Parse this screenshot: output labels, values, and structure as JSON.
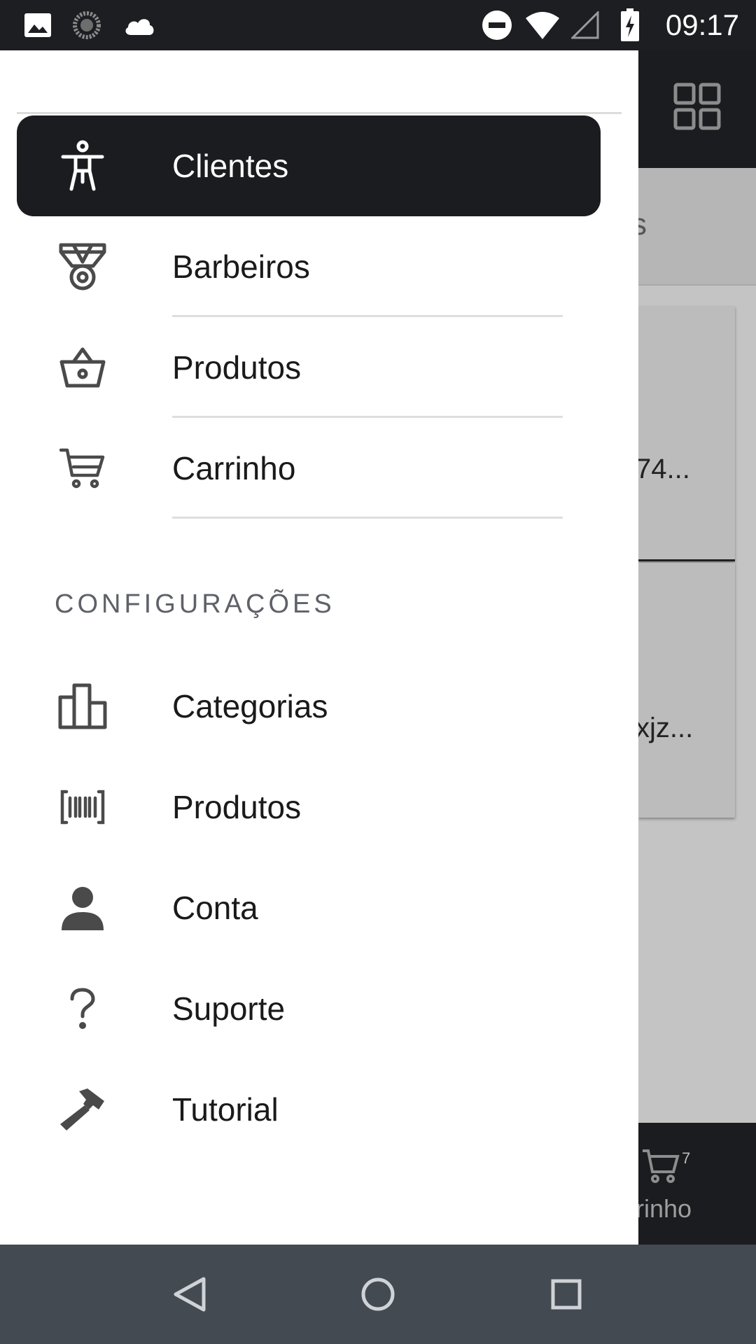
{
  "status_bar": {
    "time": "09:17",
    "icons": [
      "image-icon",
      "sync-icon",
      "cloud-icon",
      "do-not-disturb-icon",
      "wifi-icon",
      "signal-icon",
      "battery-charging-icon"
    ]
  },
  "background_app": {
    "tab_fragment": "s",
    "card1_fragment": "74...",
    "card2_fragment": "xjz...",
    "bottom_cart_label": "rrinho",
    "bottom_cart_badge": "7"
  },
  "drawer": {
    "items": [
      {
        "label": "Clientes",
        "icon": "accessibility-icon",
        "active": true
      },
      {
        "label": "Barbeiros",
        "icon": "medal-icon"
      },
      {
        "label": "Produtos",
        "icon": "basket-icon"
      },
      {
        "label": "Carrinho",
        "icon": "cart-icon"
      }
    ],
    "section_title": "CONFIGURAÇÕES",
    "settings_items": [
      {
        "label": "Categorias",
        "icon": "bar-chart-icon"
      },
      {
        "label": "Produtos",
        "icon": "barcode-icon"
      },
      {
        "label": "Conta",
        "icon": "person-icon"
      },
      {
        "label": "Suporte",
        "icon": "help-icon"
      },
      {
        "label": "Tutorial",
        "icon": "hammer-icon"
      }
    ]
  },
  "colors": {
    "drawer_active_bg": "#1b1c20",
    "status_bar_bg": "#1d1e22",
    "nav_bar_bg": "#434a52",
    "section_title": "#5f6168"
  }
}
